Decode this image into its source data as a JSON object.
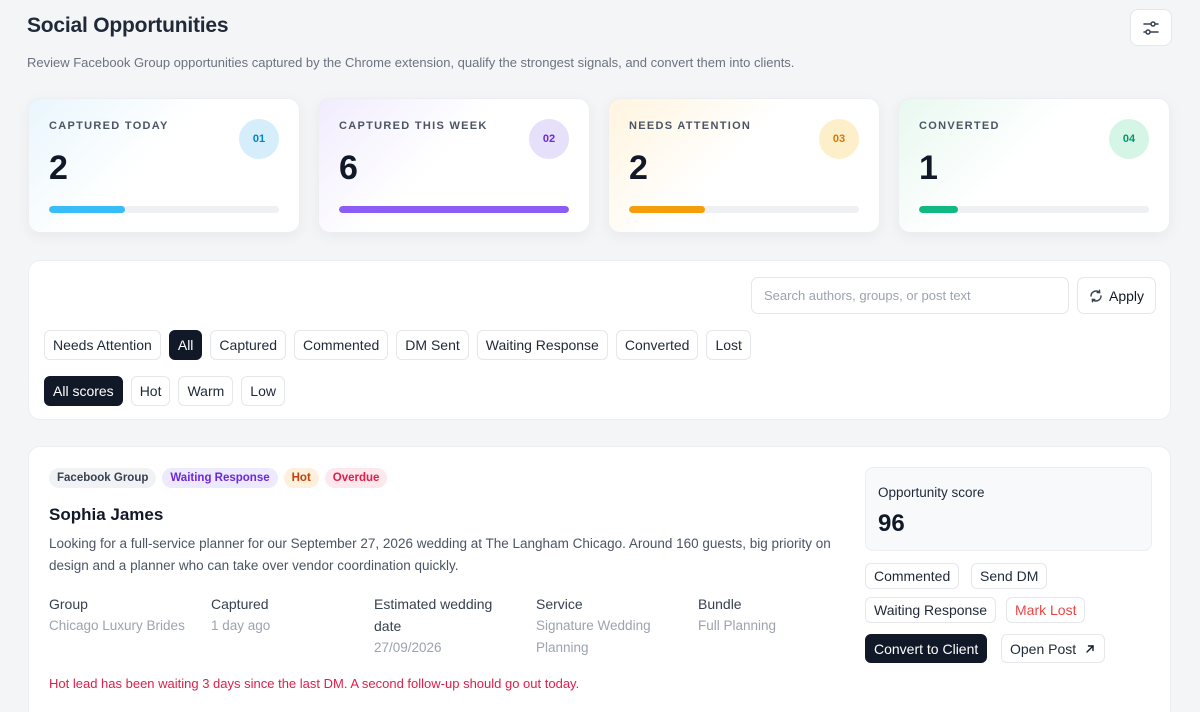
{
  "header": {
    "title": "Social Opportunities",
    "subtitle": "Review Facebook Group opportunities captured by the Chrome extension, qualify the strongest signals, and convert them into clients.",
    "settings_icon": "sliders-icon"
  },
  "stats": [
    {
      "label": "CAPTURED TODAY",
      "value": "2",
      "index": "01",
      "progress": 0.33,
      "accent": "#38bdf8",
      "badge_bg": "#d6eefb",
      "badge_fg": "#0284c7"
    },
    {
      "label": "CAPTURED THIS WEEK",
      "value": "6",
      "index": "02",
      "progress": 1.0,
      "accent": "#8b5cf6",
      "badge_bg": "#e6e0fb",
      "badge_fg": "#6d28d9"
    },
    {
      "label": "NEEDS ATTENTION",
      "value": "2",
      "index": "03",
      "progress": 0.33,
      "accent": "#f59e0b",
      "badge_bg": "#fdefc9",
      "badge_fg": "#d97706"
    },
    {
      "label": "CONVERTED",
      "value": "1",
      "index": "04",
      "progress": 0.17,
      "accent": "#10b981",
      "badge_bg": "#d5f5e6",
      "badge_fg": "#059669"
    }
  ],
  "filters": {
    "search_placeholder": "Search authors, groups, or post text",
    "search_value": "",
    "apply_label": "Apply",
    "status_chips": [
      "Needs Attention",
      "All",
      "Captured",
      "Commented",
      "DM Sent",
      "Waiting Response",
      "Converted",
      "Lost"
    ],
    "status_active": "All",
    "score_chips": [
      "All scores",
      "Hot",
      "Warm",
      "Low"
    ],
    "score_active": "All scores"
  },
  "opportunity": {
    "tags": [
      {
        "text": "Facebook Group",
        "bg": "#f1f2f4",
        "fg": "#374151"
      },
      {
        "text": "Waiting Response",
        "bg": "#ede9fe",
        "fg": "#6d28d9"
      },
      {
        "text": "Hot",
        "bg": "#fdf0dc",
        "fg": "#c2410c"
      },
      {
        "text": "Overdue",
        "bg": "#fde8ee",
        "fg": "#e11d48"
      }
    ],
    "name": "Sophia James",
    "description": "Looking for a full-service planner for our September 27, 2026 wedding at The Langham Chicago. Around 160 guests, big priority on design and a planner who can take over vendor coordination quickly.",
    "meta": {
      "group_label": "Group",
      "group_value": "Chicago Luxury Brides",
      "captured_label": "Captured",
      "captured_value": "1 day ago",
      "date_label_1": "Estimated wedding",
      "date_label_2": "date",
      "date_value": "27/09/2026",
      "service_label": "Service",
      "service_value_1": "Signature Wedding",
      "service_value_2": "Planning",
      "bundle_label": "Bundle",
      "bundle_value": "Full Planning"
    },
    "alert": "Hot lead has been waiting 3 days since the last DM. A second follow-up should go out today.",
    "score_label": "Opportunity score",
    "score_value": "96",
    "actions": {
      "commented": "Commented",
      "send_dm": "Send DM",
      "waiting_response": "Waiting Response",
      "mark_lost": "Mark Lost",
      "convert": "Convert to Client",
      "open_post": "Open Post"
    }
  }
}
